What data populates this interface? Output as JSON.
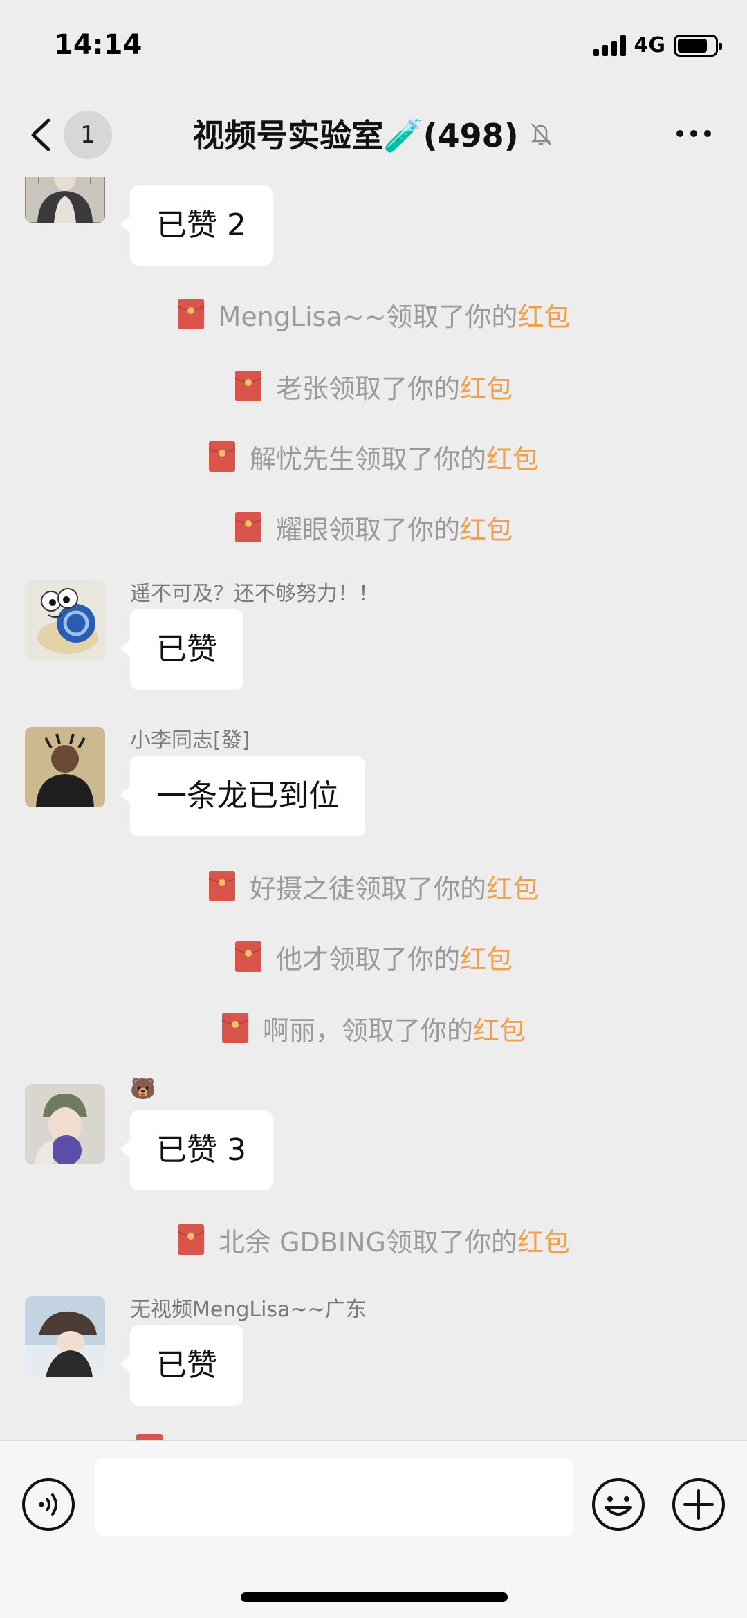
{
  "status_bar": {
    "time": "14:14",
    "network": "4G",
    "battery_level": 0.8
  },
  "nav": {
    "back_count": "1",
    "title": "视频号实验室🧪(498)"
  },
  "messages": [
    {
      "type": "chat",
      "sender": "",
      "text": "已赞 2"
    },
    {
      "type": "system",
      "prefix": "MengLisa~~领取了你的",
      "highlight": "红包"
    },
    {
      "type": "system",
      "prefix": "老张领取了你的",
      "highlight": "红包"
    },
    {
      "type": "system",
      "prefix": "解忧先生领取了你的",
      "highlight": "红包"
    },
    {
      "type": "system",
      "prefix": "耀眼领取了你的",
      "highlight": "红包"
    },
    {
      "type": "chat",
      "sender": "遥不可及？还不够努力！！",
      "text": "已赞"
    },
    {
      "type": "chat",
      "sender": "小李同志[發]",
      "text": "一条龙已到位"
    },
    {
      "type": "system",
      "prefix": "好摄之徒领取了你的",
      "highlight": "红包"
    },
    {
      "type": "system",
      "prefix": "他才领取了你的",
      "highlight": "红包"
    },
    {
      "type": "system",
      "prefix": "啊丽，领取了你的",
      "highlight": "红包"
    },
    {
      "type": "chat",
      "sender": "🐻",
      "text": "已赞 3"
    },
    {
      "type": "system",
      "prefix": "北余 GDBING领取了你的",
      "highlight": "红包"
    },
    {
      "type": "chat",
      "sender": "无视频MengLisa~~广东",
      "text": "已赞"
    }
  ],
  "colors": {
    "background": "#ededed",
    "bubble": "#ffffff",
    "red_packet_text": "#f0a04b",
    "red_packet_icon": "#d9544a",
    "system_text": "#9a9a9a"
  },
  "icons": {
    "back": "chevron-left-icon",
    "mute": "bell-slash-icon",
    "more": "ellipsis-icon",
    "red_packet": "red-envelope-icon",
    "voice": "voice-icon",
    "emoji": "emoji-icon",
    "plus": "plus-icon"
  }
}
